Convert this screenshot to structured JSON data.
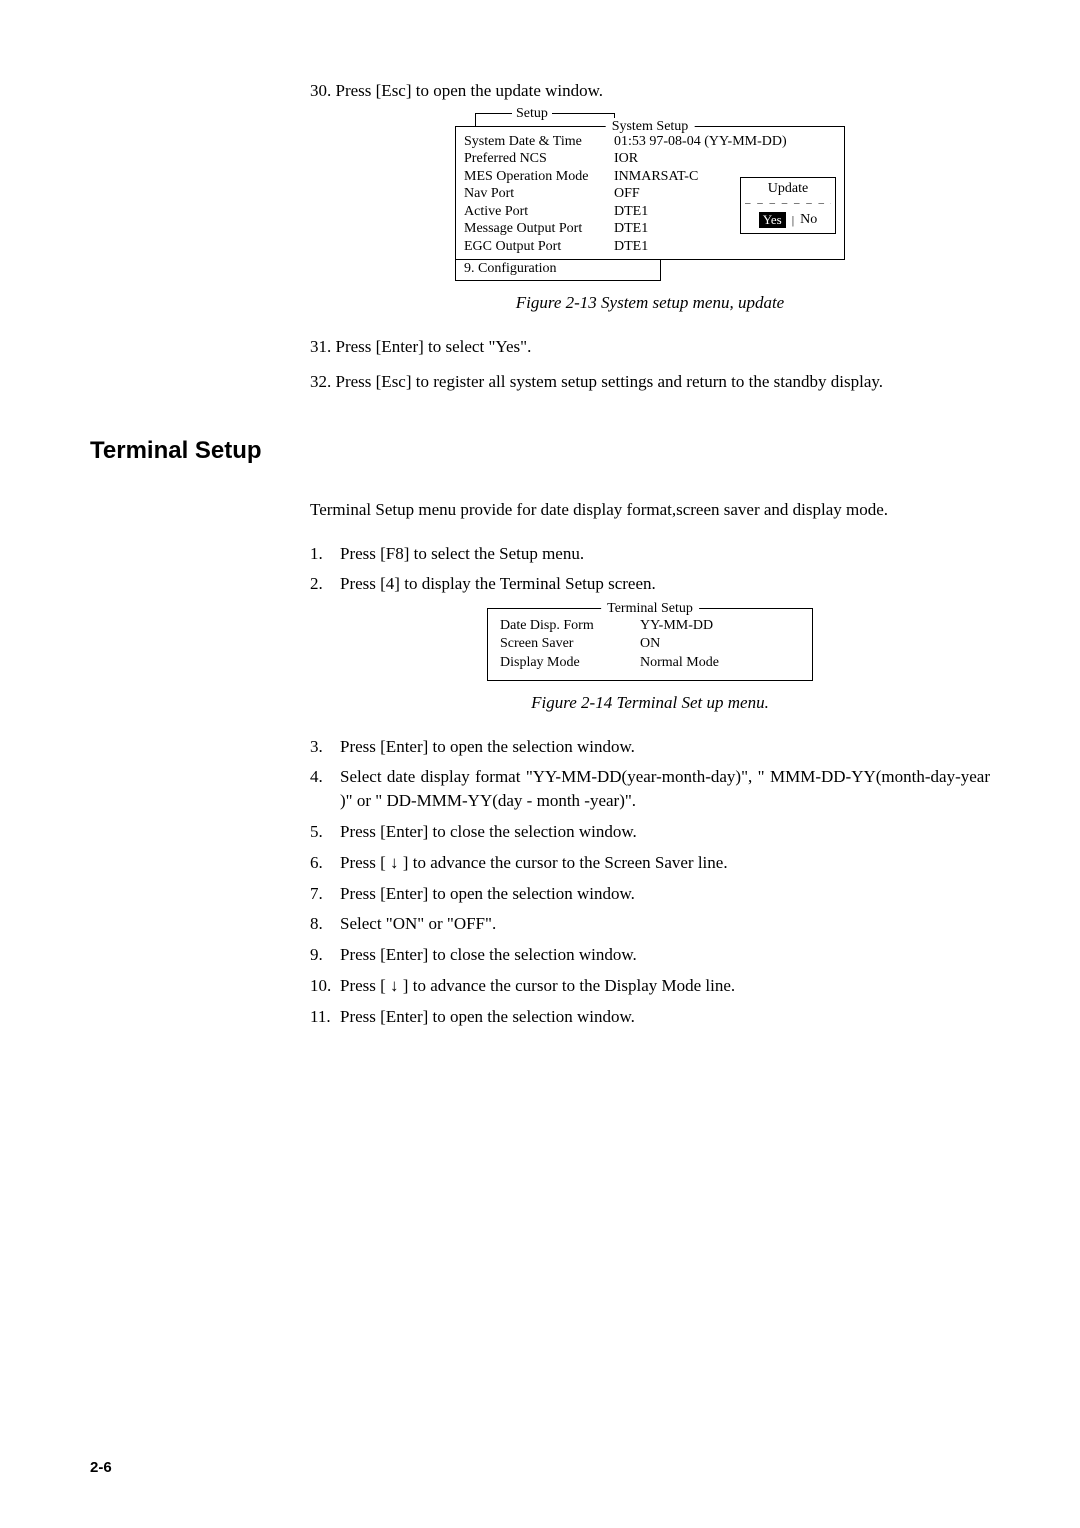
{
  "step30": "30. Press [Esc] to open the update window.",
  "sysSetup": {
    "setupLabel": "Setup",
    "title": "System Setup",
    "rows": [
      {
        "k": "System Date & Time",
        "v": "01:53  97-08-04 (YY-MM-DD)"
      },
      {
        "k": "Preferred NCS",
        "v": "IOR"
      },
      {
        "k": "MES Operation Mode",
        "v": "INMARSAT-C"
      },
      {
        "k": "Nav Port",
        "v": "OFF"
      },
      {
        "k": "Active Port",
        "v": "DTE1"
      },
      {
        "k": "Message Output Port",
        "v": "DTE1"
      },
      {
        "k": "EGC Output Port",
        "v": "DTE1"
      }
    ],
    "update": {
      "title": "Update",
      "yes": "Yes",
      "no": "No"
    },
    "configLine": "9. Configuration"
  },
  "fig213": "Figure 2-13 System setup menu, update",
  "step31": "31. Press [Enter] to select \"Yes\".",
  "step32": "32. Press [Esc] to register all system setup settings and return to the standby display.",
  "heading": "Terminal Setup",
  "introPara": "Terminal Setup menu provide for date display format,screen saver and display mode.",
  "listA": [
    {
      "n": "1.",
      "t": "Press [F8]  to select the Setup menu."
    },
    {
      "n": "2.",
      "t": "Press [4]  to display the Terminal Setup screen."
    }
  ],
  "termSetup": {
    "title": "Terminal Setup",
    "rows": [
      {
        "k": "Date Disp. Form",
        "v": "YY-MM-DD"
      },
      {
        "k": "Screen Saver",
        "v": "ON"
      },
      {
        "k": "Display Mode",
        "v": "Normal Mode"
      }
    ]
  },
  "fig214": "Figure 2-14  Terminal Set up menu.",
  "listB": [
    {
      "n": "3.",
      "t": "Press [Enter] to open the selection window."
    },
    {
      "n": "4.",
      "t": "Select date display format \"YY-MM-DD(year-month-day)\", \" MMM-DD-YY(month-day-year )\" or \" DD-MMM-YY(day - month -year)\"."
    },
    {
      "n": "5.",
      "t": "Press [Enter] to close the selection window."
    },
    {
      "n": "6.",
      "t": "Press [ ↓ ] to advance the cursor to the Screen Saver line."
    },
    {
      "n": "7.",
      "t": "Press [Enter] to open the selection window."
    },
    {
      "n": "8.",
      "t": "Select \"ON\" or \"OFF\"."
    },
    {
      "n": "9.",
      "t": "Press [Enter] to close the selection window."
    },
    {
      "n": "10.",
      "t": "Press [ ↓ ] to advance the cursor to the Display Mode line."
    },
    {
      "n": "11.",
      "t": "Press [Enter] to open the selection window."
    }
  ],
  "pageNum": "2-6"
}
